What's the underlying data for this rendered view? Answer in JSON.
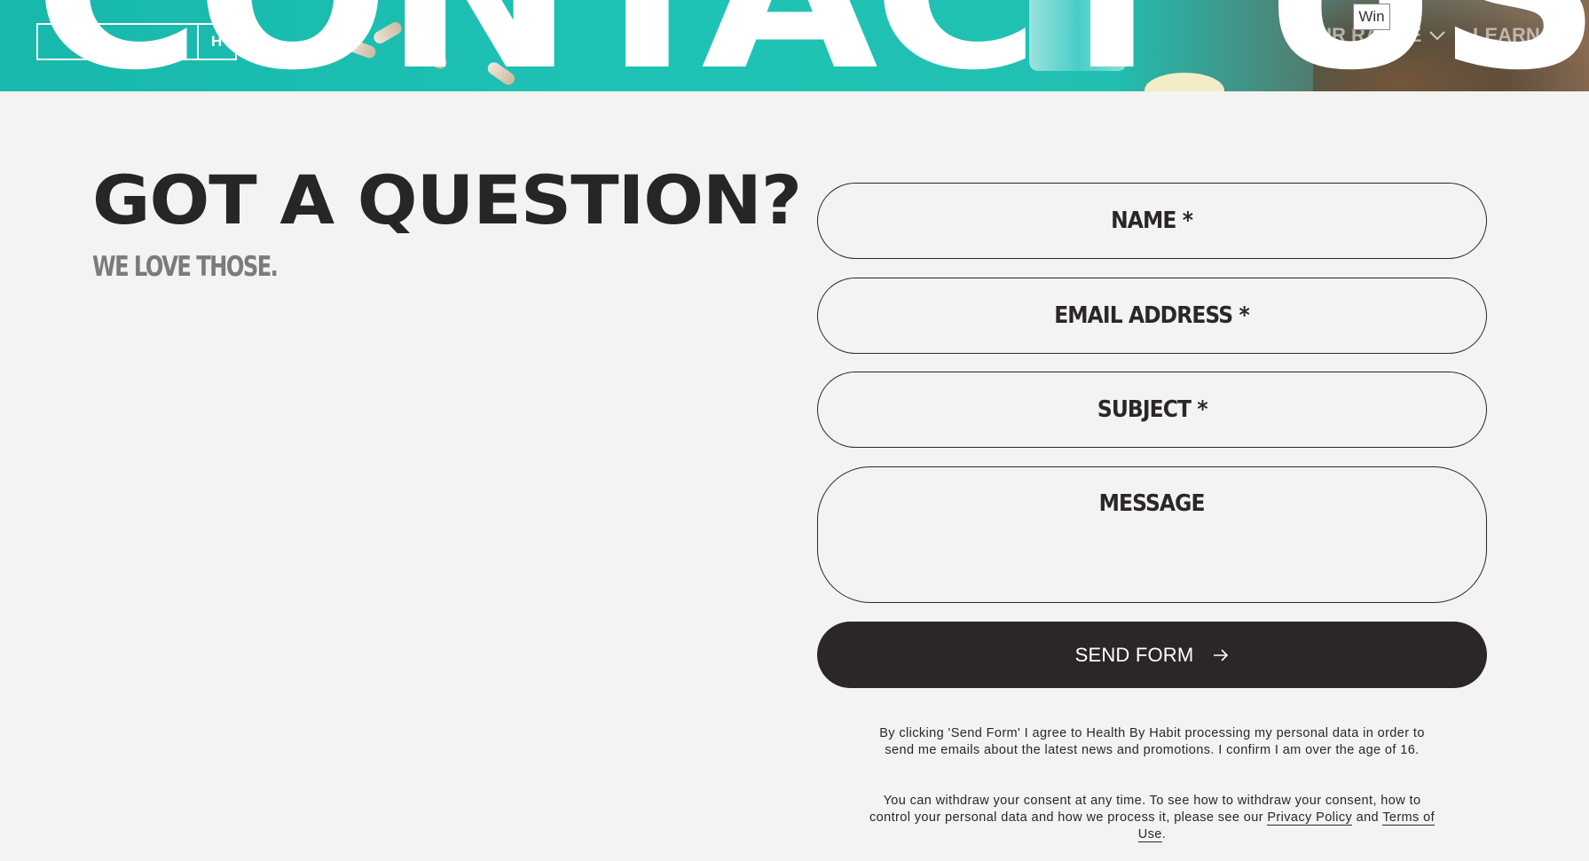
{
  "hero": {
    "big_word": "CONTACT US",
    "logo_letter": "H",
    "nav": [
      {
        "label": "OUR RANGE"
      },
      {
        "label": "LEARN"
      }
    ],
    "win_badge": "Win",
    "colors": {
      "teal": "#1fc3b5",
      "white": "#ffffff"
    }
  },
  "main": {
    "headline": "GOT A QUESTION?",
    "subline": "WE LOVE THOSE."
  },
  "form": {
    "name_placeholder": "NAME *",
    "email_placeholder": "EMAIL ADDRESS *",
    "subject_placeholder": "SUBJECT *",
    "message_placeholder": "MESSAGE",
    "send_label": "SEND FORM",
    "send_icon": "arrow-right-icon"
  },
  "consent": {
    "paragraph1": "By clicking 'Send Form' I agree to Health By Habit processing my personal data in order to send me emails about the latest news and promotions. I confirm I am over the age of 16.",
    "paragraph2_text": "You can withdraw your consent at any time. To see how to withdraw your consent, how to control your personal data and how we process it, please see our ",
    "privacy_link": "Privacy Policy",
    "and": " and ",
    "terms_link": "Terms of Use",
    "period": "."
  },
  "colors": {
    "background": "#f3f3f1",
    "text": "#2b2727",
    "subline": "#7b7b79",
    "button": "#2b2727"
  }
}
